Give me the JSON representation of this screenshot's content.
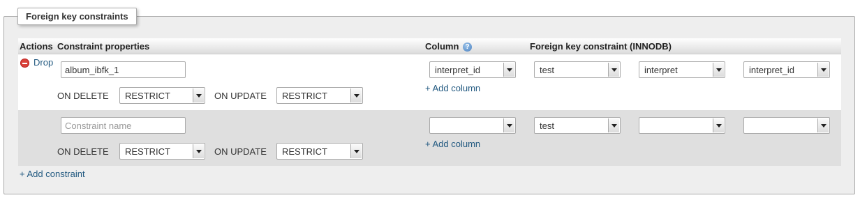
{
  "fieldset": {
    "legend": "Foreign key constraints"
  },
  "header": {
    "actions": "Actions",
    "constraint_properties": "Constraint properties",
    "column": "Column",
    "fk_constraint": "Foreign key constraint (INNODB)"
  },
  "icons": {
    "drop": "drop-circle-icon",
    "help": "help-icon"
  },
  "rows": [
    {
      "drop_label": "Drop",
      "constraint_name": "album_ibfk_1",
      "on_delete_label": "ON DELETE",
      "on_delete_value": "RESTRICT",
      "on_update_label": "ON UPDATE",
      "on_update_value": "RESTRICT",
      "column_value": "interpret_id",
      "add_column_label": "+ Add column",
      "ref_db": "test",
      "ref_table": "interpret",
      "ref_column": "interpret_id"
    },
    {
      "constraint_placeholder": "Constraint name",
      "on_delete_label": "ON DELETE",
      "on_delete_value": "RESTRICT",
      "on_update_label": "ON UPDATE",
      "on_update_value": "RESTRICT",
      "column_value": "",
      "add_column_label": "+ Add column",
      "ref_db": "test",
      "ref_table": "",
      "ref_column": ""
    }
  ],
  "add_constraint_label": "+ Add constraint"
}
